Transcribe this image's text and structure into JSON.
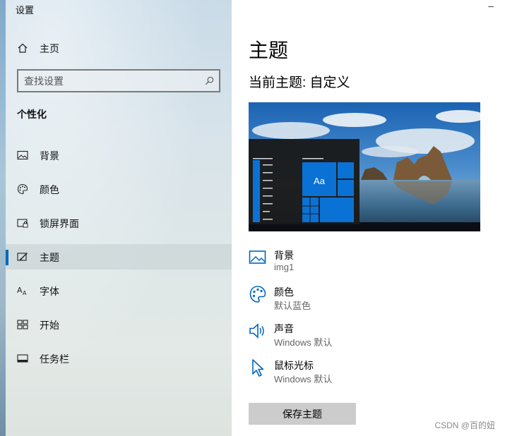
{
  "window": {
    "title": "设置",
    "minimize_glyph": "–"
  },
  "sidebar": {
    "home": {
      "label": "主页",
      "icon": "home-icon"
    },
    "search": {
      "placeholder": "查找设置",
      "icon": "search-icon"
    },
    "section_title": "个性化",
    "items": [
      {
        "label": "背景",
        "icon": "picture-icon",
        "selected": false
      },
      {
        "label": "颜色",
        "icon": "palette-icon",
        "selected": false
      },
      {
        "label": "锁屏界面",
        "icon": "lock-screen-icon",
        "selected": false
      },
      {
        "label": "主题",
        "icon": "theme-brush-icon",
        "selected": true
      },
      {
        "label": "字体",
        "icon": "font-icon",
        "selected": false
      },
      {
        "label": "开始",
        "icon": "start-menu-icon",
        "selected": false
      },
      {
        "label": "任务栏",
        "icon": "taskbar-icon",
        "selected": false
      }
    ]
  },
  "main": {
    "title": "主题",
    "current_theme": "当前主题: 自定义",
    "preview": {
      "tile_text": "Aa"
    },
    "properties": [
      {
        "name": "背景",
        "value": "img1",
        "icon": "picture-icon"
      },
      {
        "name": "颜色",
        "value": "默认蓝色",
        "icon": "palette-icon"
      },
      {
        "name": "声音",
        "value": "Windows 默认",
        "icon": "speaker-icon"
      },
      {
        "name": "鼠标光标",
        "value": "Windows 默认",
        "icon": "cursor-icon"
      }
    ],
    "save_button": "保存主题"
  },
  "watermark": "CSDN @百的妞",
  "colors": {
    "accent": "#0067c0",
    "tile_blue": "#0a72d4",
    "button_gray": "#cccccc"
  }
}
